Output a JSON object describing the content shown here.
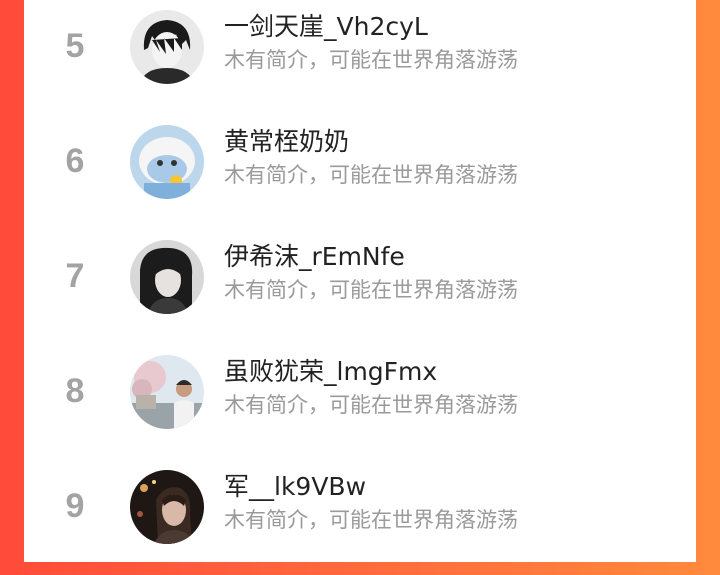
{
  "ranking": {
    "users": [
      {
        "rank": "5",
        "name": "一剑天崖_Vh2cyL",
        "bio": "木有简介，可能在世界角落游荡",
        "avatar": "anime-boy-avatar"
      },
      {
        "rank": "6",
        "name": "黄常桎奶奶",
        "bio": "木有简介，可能在世界角落游荡",
        "avatar": "cartoon-character-avatar"
      },
      {
        "rank": "7",
        "name": "伊希沫_rEmNfe",
        "bio": "木有简介，可能在世界角落游荡",
        "avatar": "woman-portrait-avatar"
      },
      {
        "rank": "8",
        "name": "虽败犹荣_lmgFmx",
        "bio": "木有简介，可能在世界角落游荡",
        "avatar": "outdoor-photo-avatar"
      },
      {
        "rank": "9",
        "name": "军__lk9VBw",
        "bio": "木有简介，可能在世界角落游荡",
        "avatar": "night-selfie-avatar"
      }
    ]
  },
  "colors": {
    "background_gradient_start": "#ff4b3a",
    "background_gradient_end": "#ff8a3c",
    "card": "#ffffff",
    "rank_text": "#a3a3a3",
    "name_text": "#222222",
    "bio_text": "#9a9a9a"
  }
}
